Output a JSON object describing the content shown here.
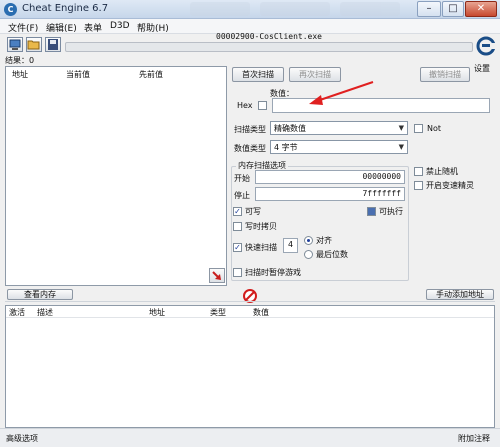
{
  "window": {
    "title": "Cheat Engine 6.7",
    "minimize": "–",
    "maximize": "□",
    "close": "✕"
  },
  "menu": [
    "文件(F)",
    "编辑(E)",
    "表单",
    "D3D",
    "帮助(H)"
  ],
  "toolbar": {
    "process_name": "00002900-CosClient.exe",
    "settings_label": "设置"
  },
  "results": {
    "label": "结果：0",
    "columns": [
      "地址",
      "当前值",
      "先前值"
    ]
  },
  "scan": {
    "first_scan": "首次扫描",
    "next_scan": "再次扫描",
    "undo_scan": "撤销扫描",
    "value_label": "数值：",
    "hex_label": "Hex",
    "value": "",
    "scan_type_label": "扫描类型",
    "scan_type": "精确数值",
    "value_type_label": "数值类型",
    "value_type": "4 字节",
    "not_label": "Not"
  },
  "memory_options": {
    "title": "内存扫描选项",
    "start_label": "开始",
    "start_value": "00000000",
    "stop_label": "停止",
    "stop_value": "7fffffff",
    "writable": "可写",
    "executable": "可执行",
    "copy_on_write": "写时拷贝",
    "fast_scan": "快速扫描",
    "fast_scan_value": "4",
    "align": "对齐",
    "last_digit": "最后位数",
    "pause_game": "扫描时暂停游戏"
  },
  "side_options": {
    "disable_random": "禁止随机",
    "speedhack": "开启变速精灵"
  },
  "buttons": {
    "view_memory": "查看内存",
    "add_manual": "手动添加地址"
  },
  "address_list": {
    "columns": [
      "激活",
      "描述",
      "地址",
      "类型",
      "数值"
    ]
  },
  "statusbar": {
    "advanced": "高级选项",
    "comments": "附加注释"
  },
  "colors": {
    "accent": "#1f3f9a",
    "annotation_arrow": "#e02020"
  }
}
